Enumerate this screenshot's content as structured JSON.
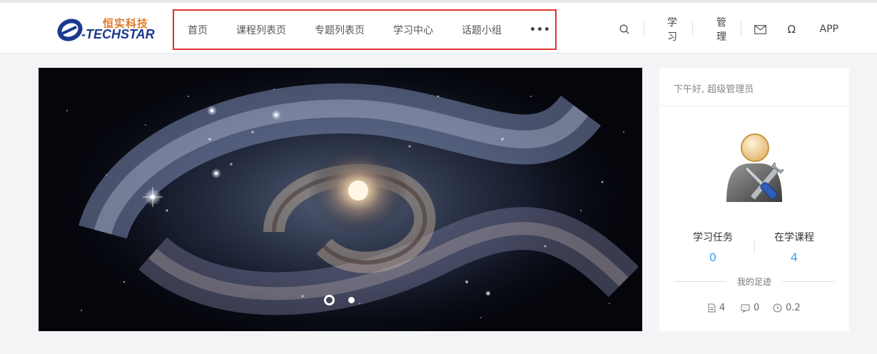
{
  "brand": {
    "cn": "恒实科技",
    "en": "-TECHSTAR"
  },
  "nav": [
    {
      "label": "首页"
    },
    {
      "label": "课程列表页"
    },
    {
      "label": "专题列表页"
    },
    {
      "label": "学习中心"
    },
    {
      "label": "话题小组"
    },
    {
      "label": "•••"
    }
  ],
  "tools": {
    "search_icon": "search-icon",
    "learn": "学习",
    "manage": "管理",
    "mail_icon": "mail-icon",
    "omega_icon": "omega-icon",
    "app": "APP"
  },
  "banner": {
    "slides": 2,
    "active": 0
  },
  "panel": {
    "greeting": "下午好, 超级管理员",
    "stats": [
      {
        "label": "学习任务",
        "value": "0"
      },
      {
        "label": "在学课程",
        "value": "4"
      }
    ],
    "footprint_title": "我的足迹",
    "footprint": [
      {
        "icon": "document-icon",
        "value": "4"
      },
      {
        "icon": "comment-icon",
        "value": "0"
      },
      {
        "icon": "clock-icon",
        "value": "0.2"
      }
    ]
  },
  "colors": {
    "accent": "#3fa0e8",
    "highlight": "#e2322f",
    "brand_blue": "#1b3a8e",
    "brand_orange": "#e07b2c"
  }
}
